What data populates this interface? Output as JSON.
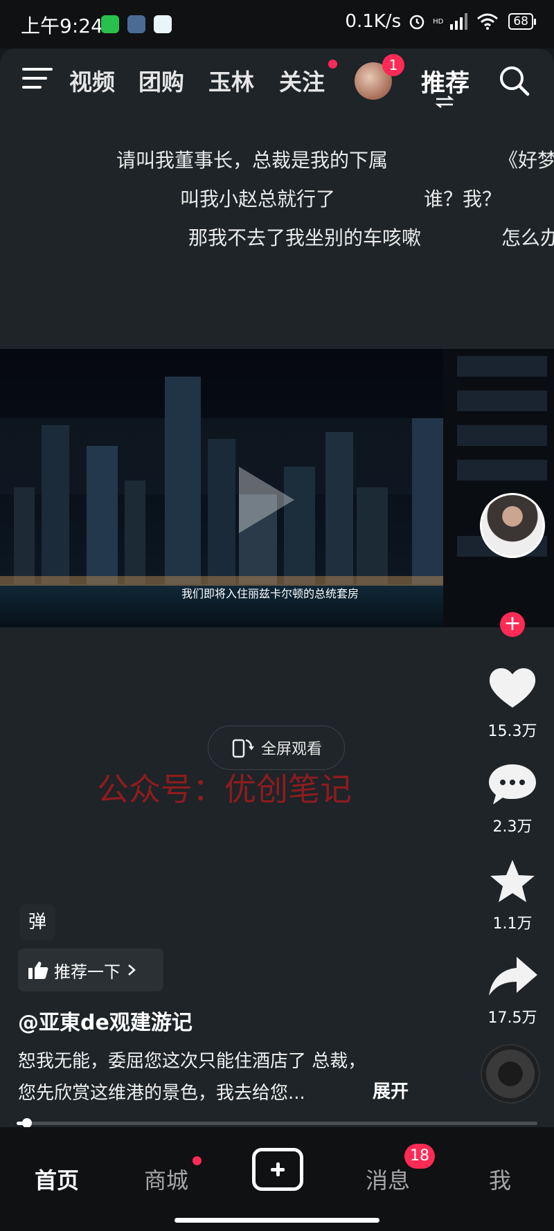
{
  "status_bar": {
    "time": "上午9:24",
    "network_speed": "0.1K/s",
    "network_type": "HD",
    "battery": "68",
    "app_icons": [
      "wechat-icon",
      "settings-app-icon",
      "cloud-app-icon"
    ],
    "indicator_icons": [
      "alarm-icon",
      "signal-icon",
      "wifi-icon",
      "battery-icon"
    ]
  },
  "top_nav": {
    "tabs": [
      "视频",
      "团购",
      "玉林",
      "关注"
    ],
    "active_tab": "推荐",
    "follow_has_dot": true,
    "avatar_badge": "1",
    "icons": [
      "menu-icon",
      "search-icon",
      "swap-icon"
    ]
  },
  "danmaku": {
    "row1a": "请叫我董事长，总裁是我的下属",
    "row1b": "《好梦",
    "row2a": "叫我小赵总就行了",
    "row2b": "谁？我？",
    "row3a": "那我不去了我坐别的车咳嗽",
    "row3b": "怎么办"
  },
  "video": {
    "subtitle": "我们即将入住丽兹卡尔顿的总统套房",
    "progress": 0.015
  },
  "fullscreen_button": {
    "label": "全屏观看"
  },
  "watermark": "公众号：优创笔记",
  "side_actions": {
    "likes": "15.3万",
    "comments": "2.3万",
    "favorites": "1.1万",
    "shares": "17.5万"
  },
  "danmu_toggle": "弹",
  "recommend_button": {
    "label": "推荐一下"
  },
  "post": {
    "username": "@亚東de观建游记",
    "desc_line1": "恕我无能，委屈您这次只能住酒店了 总裁，",
    "desc_line2": "您先欣赏这维港的景色，我去给您...",
    "expand": "展开"
  },
  "bottom_bar": {
    "home": "首页",
    "mall": "商城",
    "messages": "消息",
    "messages_badge": "18",
    "me": "我"
  },
  "colors": {
    "accent": "#ff2b55",
    "panel_bg": "#1e2428",
    "bar_bg": "#0f1113",
    "watermark": "#8d1c1e"
  }
}
